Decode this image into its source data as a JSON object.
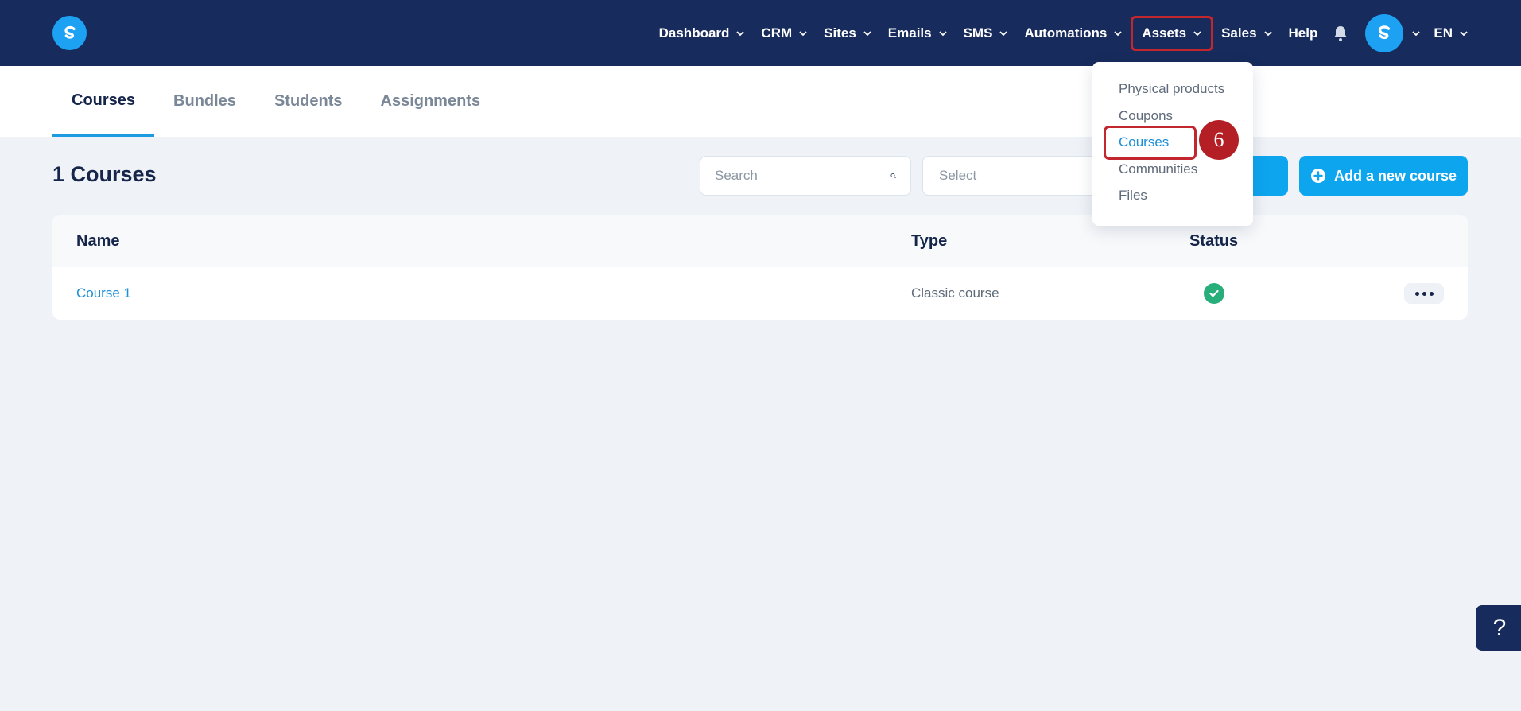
{
  "brand": {
    "logo_letter": "S"
  },
  "nav": {
    "items": [
      {
        "label": "Dashboard",
        "has_chevron": true
      },
      {
        "label": "CRM",
        "has_chevron": true
      },
      {
        "label": "Sites",
        "has_chevron": true
      },
      {
        "label": "Emails",
        "has_chevron": true
      },
      {
        "label": "SMS",
        "has_chevron": true
      },
      {
        "label": "Automations",
        "has_chevron": true
      },
      {
        "label": "Assets",
        "has_chevron": true,
        "highlighted": true
      },
      {
        "label": "Sales",
        "has_chevron": true
      },
      {
        "label": "Help",
        "has_chevron": false
      }
    ],
    "notification_icon": "bell-icon",
    "avatar_letter": "S",
    "language": "EN"
  },
  "tabs": [
    {
      "label": "Courses",
      "active": true
    },
    {
      "label": "Bundles",
      "active": false
    },
    {
      "label": "Students",
      "active": false
    },
    {
      "label": "Assignments",
      "active": false
    }
  ],
  "toolbar": {
    "title": "1 Courses",
    "search_placeholder": "Search",
    "select_placeholder": "Select",
    "add_button_label": "Add a new course"
  },
  "table": {
    "columns": {
      "name": "Name",
      "type": "Type",
      "status": "Status"
    },
    "rows": [
      {
        "name": "Course 1",
        "type": "Classic course",
        "status": "active"
      }
    ]
  },
  "assets_menu": {
    "items": [
      {
        "label": "Physical products"
      },
      {
        "label": "Coupons"
      },
      {
        "label": "Courses",
        "active": true
      },
      {
        "label": "Communities"
      },
      {
        "label": "Files"
      }
    ]
  },
  "annotation": {
    "step_number": "6"
  },
  "help_widget": {
    "label": "?"
  },
  "colors": {
    "topbar": "#172b5c",
    "accent": "#0ea5ef",
    "highlight": "#c1272d",
    "status_ok": "#27ae7a"
  }
}
